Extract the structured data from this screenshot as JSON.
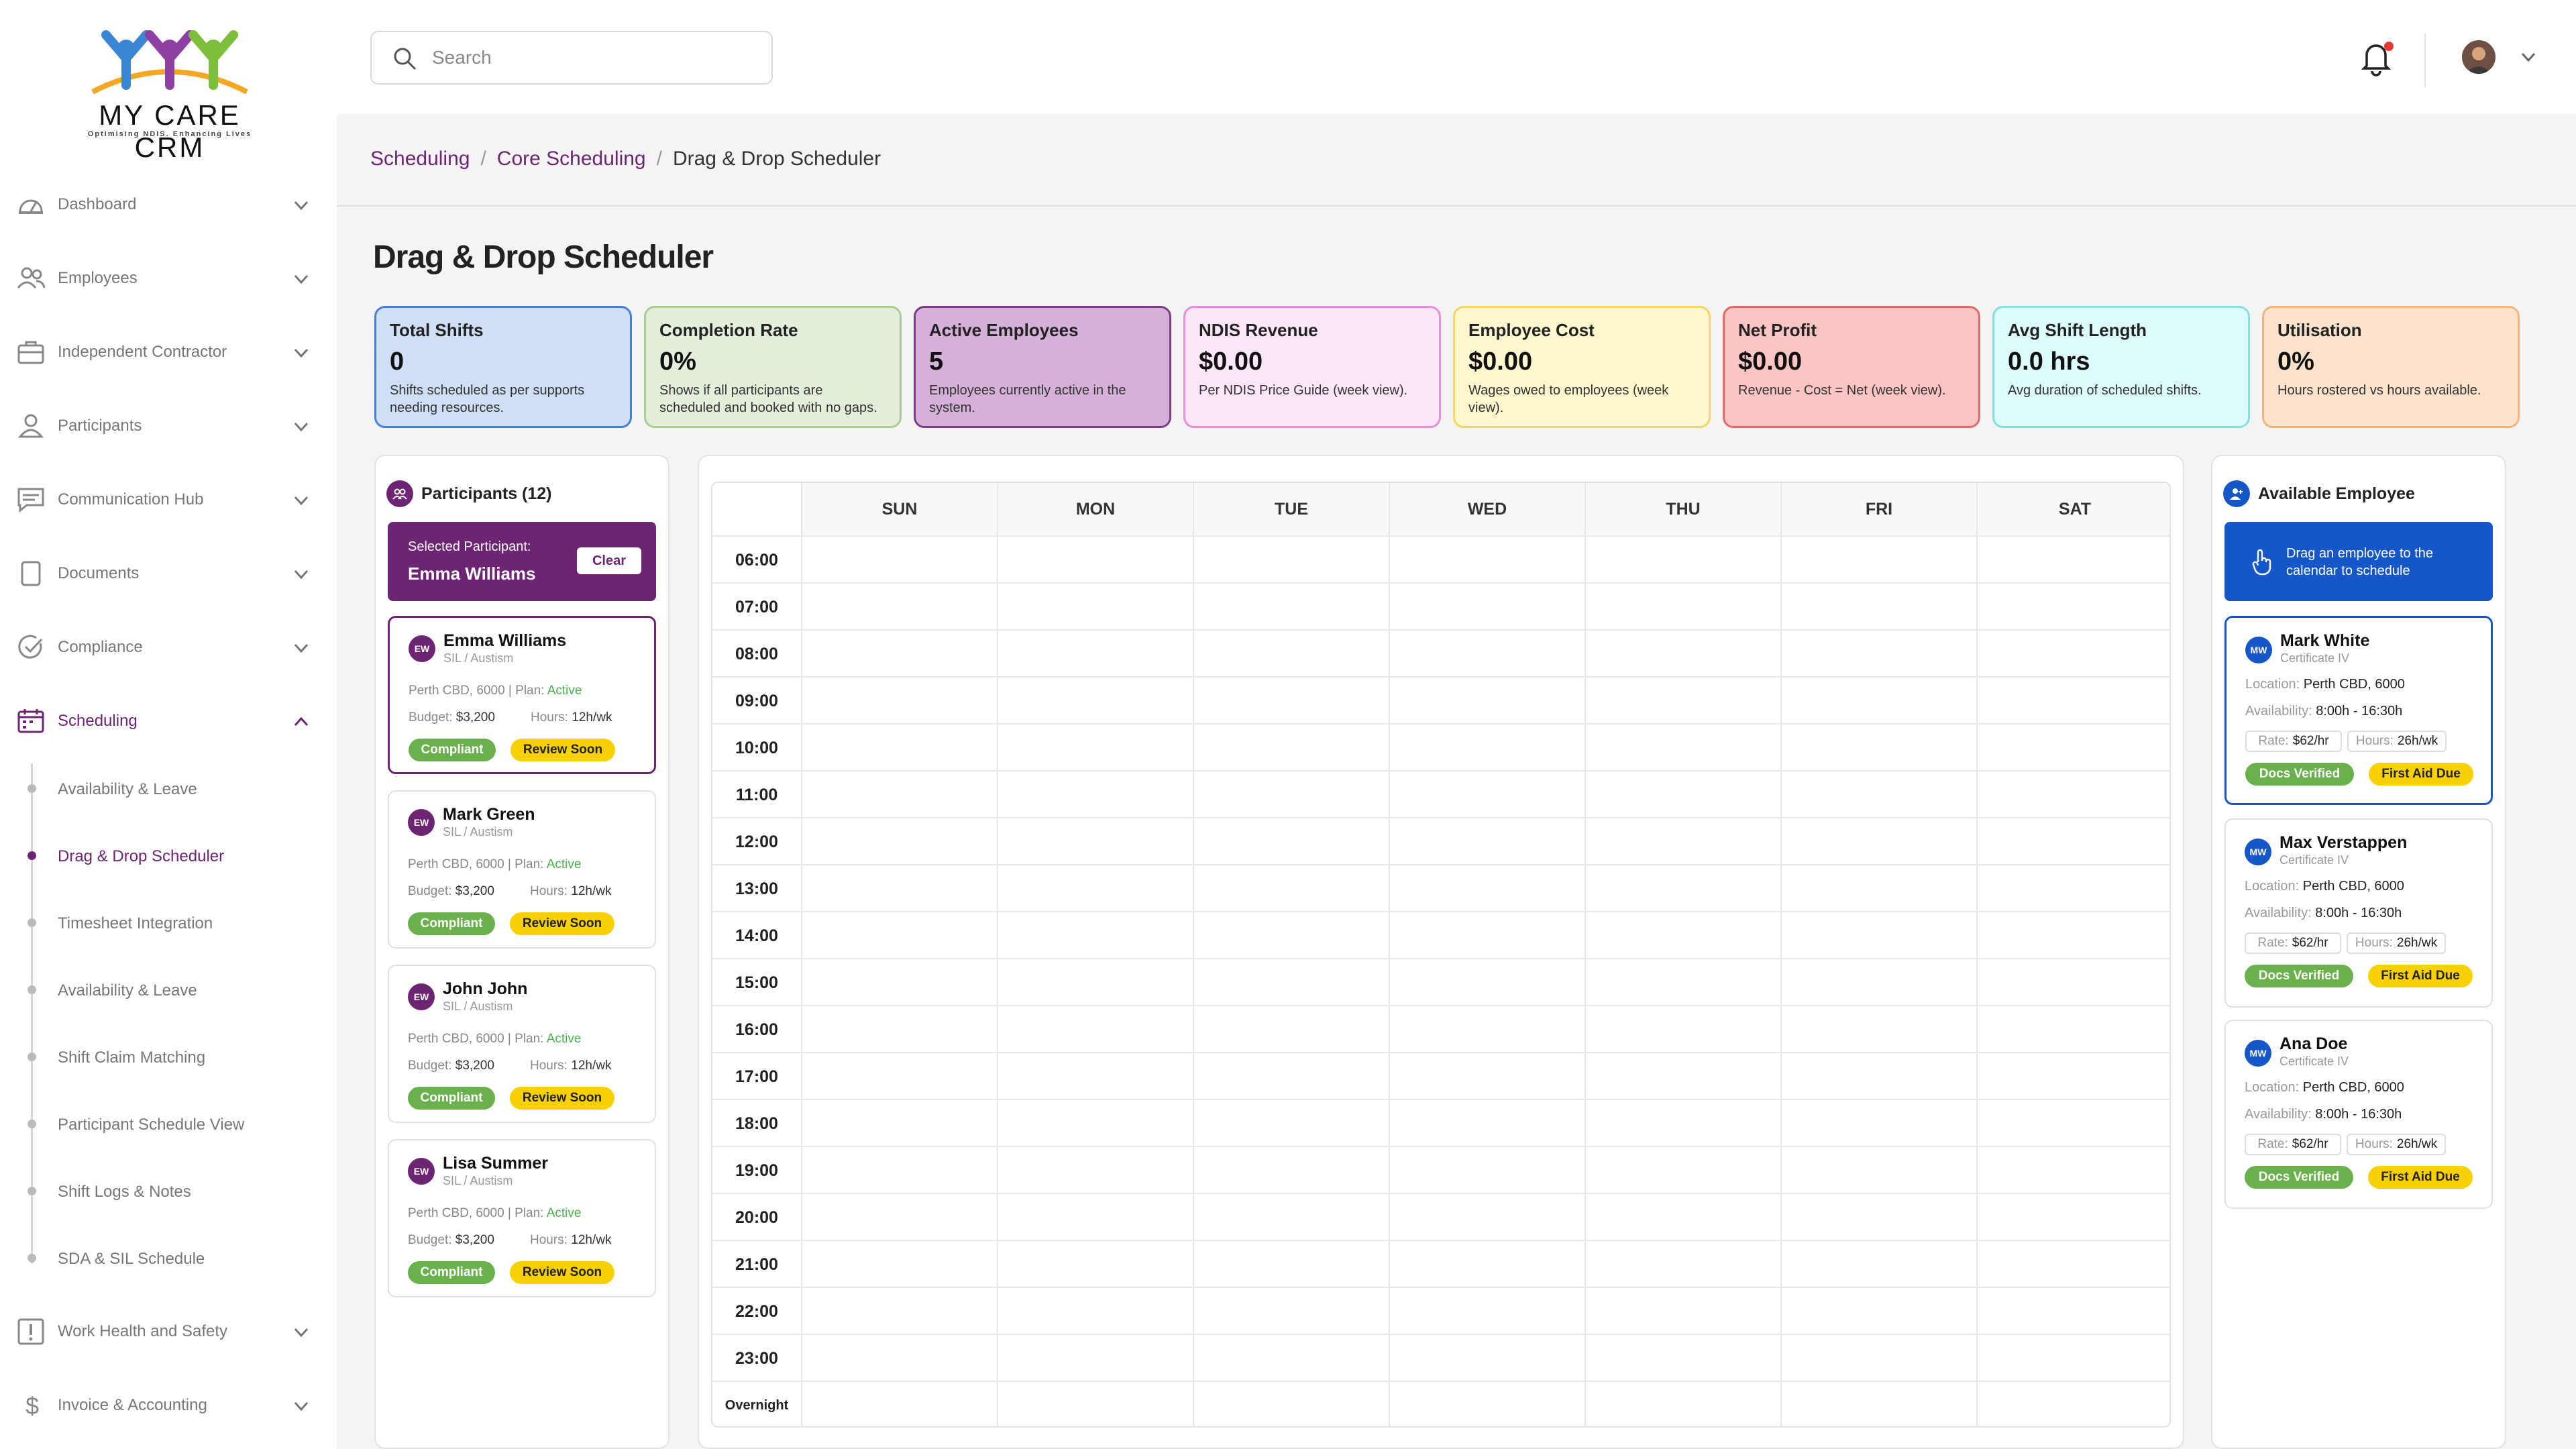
{
  "brand": {
    "name": "MY CARE CRM",
    "tagline": "Optimising NDIS. Enhancing Lives"
  },
  "search": {
    "placeholder": "Search"
  },
  "sidebar": {
    "items": [
      {
        "label": "Dashboard",
        "icon": "dashboard-icon"
      },
      {
        "label": "Employees",
        "icon": "employees-icon"
      },
      {
        "label": "Independent Contractor",
        "icon": "briefcase-icon"
      },
      {
        "label": "Participants",
        "icon": "user-icon"
      },
      {
        "label": "Communication Hub",
        "icon": "chat-icon"
      },
      {
        "label": "Documents",
        "icon": "document-icon"
      },
      {
        "label": "Compliance",
        "icon": "check-circle-icon"
      },
      {
        "label": "Scheduling",
        "icon": "calendar-icon"
      },
      {
        "label": "Work Health and Safety",
        "icon": "alert-icon"
      },
      {
        "label": "Invoice & Accounting",
        "icon": "dollar-icon"
      }
    ],
    "scheduling_sub": [
      "Availability & Leave",
      "Drag & Drop Scheduler",
      "Timesheet Integration",
      "Availability & Leave",
      "Shift Claim Matching",
      "Participant Schedule View",
      "Shift Logs & Notes",
      "SDA & SIL Schedule"
    ]
  },
  "breadcrumb": [
    "Scheduling",
    "Core Scheduling",
    "Drag & Drop Scheduler"
  ],
  "breadcrumb_sep": "/",
  "page_title": "Drag & Drop Scheduler",
  "stats": [
    {
      "title": "Total Shifts",
      "value": "0",
      "desc": "Shifts scheduled as per supports needing resources.",
      "bg": "#cfdff5",
      "border": "#4a7fd6"
    },
    {
      "title": "Completion Rate",
      "value": "0%",
      "desc": "Shows if all participants are scheduled and booked with no gaps.",
      "bg": "#e3efda",
      "border": "#a8cf8f"
    },
    {
      "title": "Active Employees",
      "value": "5",
      "desc": "Employees currently active in the system.",
      "bg": "#d5b0d9",
      "border": "#7a3e86"
    },
    {
      "title": "NDIS Revenue",
      "value": "$0.00",
      "desc": "Per NDIS Price Guide (week view).",
      "bg": "#fde6f8",
      "border": "#e88fd6"
    },
    {
      "title": "Employee Cost",
      "value": "$0.00",
      "desc": "Wages owed to employees (week view).",
      "bg": "#fff8cf",
      "border": "#f1d75e"
    },
    {
      "title": "Net Profit",
      "value": "$0.00",
      "desc": "Revenue - Cost = Net (week view).",
      "bg": "#fdc4c4",
      "border": "#e06b6b"
    },
    {
      "title": "Avg Shift Length",
      "value": "0.0 hrs",
      "desc": "Avg duration of scheduled shifts.",
      "bg": "#dcfbfb",
      "border": "#86dede"
    },
    {
      "title": "Utilisation",
      "value": "0%",
      "desc": "Hours rostered vs hours available.",
      "bg": "#fde3cc",
      "border": "#f2b57c"
    }
  ],
  "participants": {
    "heading": "Participants (12)",
    "selected_label": "Selected Participant:",
    "selected_name": "Emma Williams",
    "clear_label": "Clear",
    "plan_label": "Plan:",
    "budget_label": "Budget:",
    "hours_label": "Hours:",
    "list": [
      {
        "initials": "EW",
        "name": "Emma Williams",
        "type": "SIL / Austism",
        "location": "Perth CBD, 6000",
        "plan": "Active",
        "budget": "$3,200",
        "hours": "12h/wk",
        "badges": [
          "Compliant",
          "Review Soon"
        ]
      },
      {
        "initials": "EW",
        "name": "Mark Green",
        "type": "SIL / Austism",
        "location": "Perth CBD, 6000",
        "plan": "Active",
        "budget": "$3,200",
        "hours": "12h/wk",
        "badges": [
          "Compliant",
          "Review Soon"
        ]
      },
      {
        "initials": "EW",
        "name": "John John",
        "type": "SIL / Austism",
        "location": "Perth CBD, 6000",
        "plan": "Active",
        "budget": "$3,200",
        "hours": "12h/wk",
        "badges": [
          "Compliant",
          "Review Soon"
        ]
      },
      {
        "initials": "EW",
        "name": "Lisa Summer",
        "type": "SIL / Austism",
        "location": "Perth CBD, 6000",
        "plan": "Active",
        "budget": "$3,200",
        "hours": "12h/wk",
        "badges": [
          "Compliant",
          "Review Soon"
        ]
      }
    ]
  },
  "calendar": {
    "days": [
      "SUN",
      "MON",
      "TUE",
      "WED",
      "THU",
      "FRI",
      "SAT"
    ],
    "times": [
      "06:00",
      "07:00",
      "08:00",
      "09:00",
      "10:00",
      "11:00",
      "12:00",
      "13:00",
      "14:00",
      "15:00",
      "16:00",
      "17:00",
      "18:00",
      "19:00",
      "20:00",
      "21:00",
      "22:00",
      "23:00",
      "Overnight"
    ]
  },
  "employees": {
    "heading": "Available Employee",
    "drag_hint": "Drag an employee to the calendar to schedule",
    "location_label": "Location:",
    "availability_label": "Availability:",
    "rate_label": "Rate:",
    "hours_label": "Hours:",
    "list": [
      {
        "initials": "MW",
        "name": "Mark White",
        "cert": "Certificate IV",
        "location": "Perth CBD, 6000",
        "availability": "8:00h - 16:30h",
        "rate": "$62/hr",
        "hours": "26h/wk",
        "badges": [
          "Docs Verified",
          "First Aid Due"
        ]
      },
      {
        "initials": "MW",
        "name": "Max Verstappen",
        "cert": "Certificate IV",
        "location": "Perth CBD, 6000",
        "availability": "8:00h - 16:30h",
        "rate": "$62/hr",
        "hours": "26h/wk",
        "badges": [
          "Docs Verified",
          "First Aid Due"
        ]
      },
      {
        "initials": "MW",
        "name": "Ana Doe",
        "cert": "Certificate IV",
        "location": "Perth CBD, 6000",
        "availability": "8:00h - 16:30h",
        "rate": "$62/hr",
        "hours": "26h/wk",
        "badges": [
          "Docs Verified",
          "First Aid Due"
        ]
      }
    ]
  },
  "colors": {
    "accent": "#6c2473",
    "employee_blue": "#1556c8",
    "compliant": "#6ab04c",
    "warning": "#f9d000"
  }
}
